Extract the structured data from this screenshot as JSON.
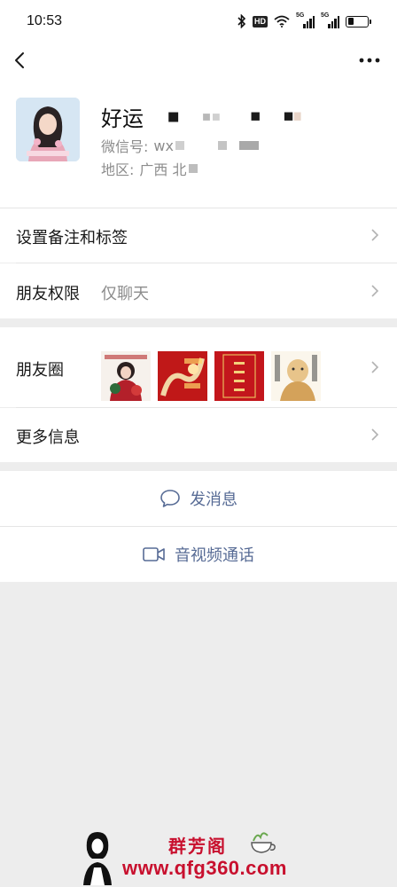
{
  "status_bar": {
    "time": "10:53",
    "hd_label": "HD",
    "sim1_label": "5G",
    "sim2_label": "5G",
    "battery_level": 0.3
  },
  "nav": {
    "back_icon": "chevron-left-icon",
    "more_icon": "more-dots-icon"
  },
  "profile": {
    "nickname": "好运",
    "wechat_id_label": "微信号:",
    "wechat_id_value": "wx",
    "region_label": "地区:",
    "region_value": "广西 北"
  },
  "menu": {
    "remark_tags": "设置备注和标签",
    "permissions_label": "朋友权限",
    "permissions_value": "仅聊天",
    "moments_label": "朋友圈",
    "more_info": "更多信息"
  },
  "actions": {
    "send_message": "发消息",
    "video_call": "音视频通话"
  },
  "watermark": {
    "brand": "群芳阁",
    "url": "www.qfg360.com"
  },
  "colors": {
    "link": "#576b95",
    "background": "#ededed",
    "watermark_red": "#c8102e"
  }
}
